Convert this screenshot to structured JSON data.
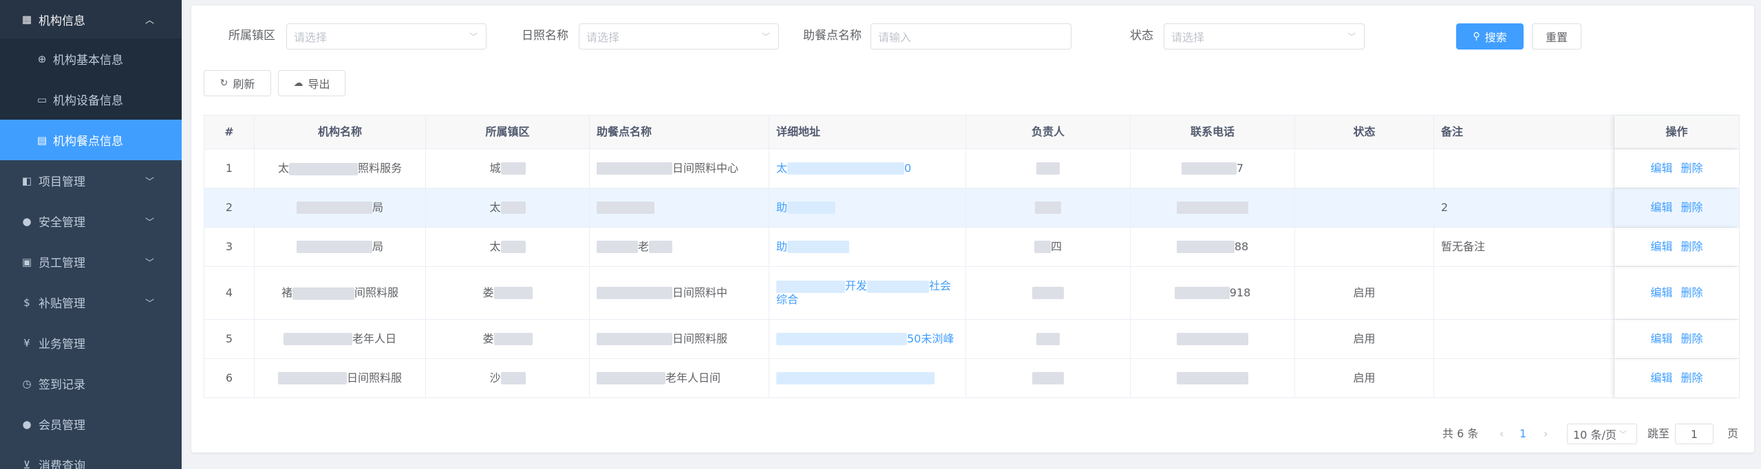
{
  "sidebar": {
    "items": [
      {
        "label": "机构信息",
        "icon": "grid-icon",
        "open": true,
        "children": [
          {
            "label": "机构基本信息",
            "icon": "globe-icon"
          },
          {
            "label": "机构设备信息",
            "icon": "monitor-icon"
          },
          {
            "label": "机构餐点信息",
            "icon": "document-icon",
            "active": true
          }
        ]
      },
      {
        "label": "项目管理",
        "icon": "layers-icon"
      },
      {
        "label": "安全管理",
        "icon": "location-pin-icon"
      },
      {
        "label": "员工管理",
        "icon": "id-card-icon"
      },
      {
        "label": "补贴管理",
        "icon": "dollar-icon"
      },
      {
        "label": "业务管理",
        "icon": "yen-icon"
      },
      {
        "label": "签到记录",
        "icon": "clock-icon"
      },
      {
        "label": "会员管理",
        "icon": "user-icon"
      },
      {
        "label": "消费查询",
        "icon": "cart-icon"
      }
    ]
  },
  "filters": {
    "town": {
      "label": "所属镇区",
      "placeholder": "请选择"
    },
    "care_name": {
      "label": "日照名称",
      "placeholder": "请选择"
    },
    "meal_point": {
      "label": "助餐点名称",
      "placeholder": "请输入"
    },
    "status": {
      "label": "状态",
      "placeholder": "请选择"
    },
    "search_button": "搜索",
    "reset_button": "重置"
  },
  "toolbar": {
    "refresh": "刷新",
    "export": "导出"
  },
  "table": {
    "headers": [
      "#",
      "机构名称",
      "所属镇区",
      "助餐点名称",
      "详细地址",
      "负责人",
      "联系电话",
      "状态",
      "备注",
      "操作"
    ],
    "rows": [
      {
        "index": "1",
        "org": "太",
        "org2": "照料服务",
        "town": "城",
        "point": "日间照料中心",
        "address": "太",
        "address2": "0",
        "person": "",
        "phone": "7",
        "status": "",
        "remark": ""
      },
      {
        "index": "2",
        "org": "",
        "org2": "局",
        "town": "太",
        "point": "",
        "address": "助",
        "address2": "",
        "person": "",
        "phone": "",
        "status": "",
        "remark": "2"
      },
      {
        "index": "3",
        "org": "",
        "org2": "局",
        "town": "太",
        "point": "老",
        "address": "助",
        "address2": "",
        "person": "四",
        "phone": "88",
        "status": "",
        "remark": "暂无备注"
      },
      {
        "index": "4",
        "org": "褚",
        "org2": "间照料服",
        "town": "娄",
        "point": "日间照料中",
        "address": "开发",
        "address2": "社会综合",
        "person": "",
        "phone": "918",
        "status": "启用",
        "remark": ""
      },
      {
        "index": "5",
        "org": "",
        "org2": "老年人日",
        "town": "娄",
        "point": "日间照料服",
        "address": "",
        "address2": "50未浏峰",
        "person": "",
        "phone": "",
        "status": "启用",
        "remark": ""
      },
      {
        "index": "6",
        "org": "",
        "org2": "日间照料服",
        "town": "沙",
        "point": "老年人日间",
        "address": "",
        "address2": "",
        "person": "",
        "phone": "",
        "status": "启用",
        "remark": ""
      }
    ],
    "edit_label": "编辑",
    "delete_label": "删除"
  },
  "pagination": {
    "total": "共 6 条",
    "current_page": "1",
    "page_size": "10 条/页",
    "jump_label": "跳至",
    "jump_value": "1",
    "page_unit": "页"
  },
  "colors": {
    "sidebar_bg": "#304156",
    "accent": "#409eff"
  }
}
